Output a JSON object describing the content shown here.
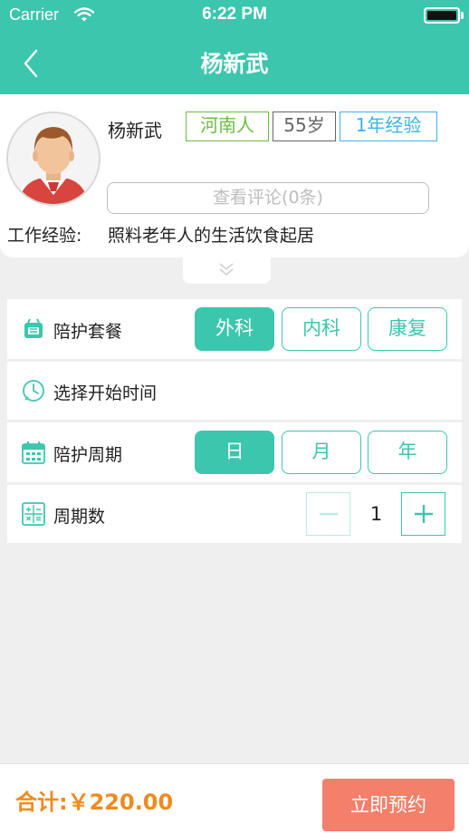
{
  "status_bar": {
    "carrier": "Carrier",
    "time": "6:22 PM"
  },
  "nav": {
    "title": "杨新武",
    "back_icon": "chevron-left-icon"
  },
  "profile": {
    "name": "杨新武",
    "tags": [
      {
        "text": "河南人",
        "color": "#6dbb44"
      },
      {
        "text": "55岁",
        "color": "#666666"
      },
      {
        "text": "1年经验",
        "color": "#39b4e6"
      }
    ],
    "review_button": "查看评论(0条)",
    "experience_label": "工作经验:",
    "experience_value": "照料老年人的生活饮食起居"
  },
  "form": {
    "package": {
      "label": "陪护套餐",
      "options": [
        "外科",
        "内科",
        "康复"
      ],
      "selected": "外科"
    },
    "start_time": {
      "label": "选择开始时间"
    },
    "cycle": {
      "label": "陪护周期",
      "options": [
        "日",
        "月",
        "年"
      ],
      "selected": "日"
    },
    "cycle_count": {
      "label": "周期数",
      "value": "1"
    }
  },
  "footer": {
    "total": "合计:￥220.00",
    "book_button": "立即预约"
  },
  "colors": {
    "accent": "#3cc6ae",
    "price": "#f08a1c",
    "book": "#f47f6a"
  }
}
